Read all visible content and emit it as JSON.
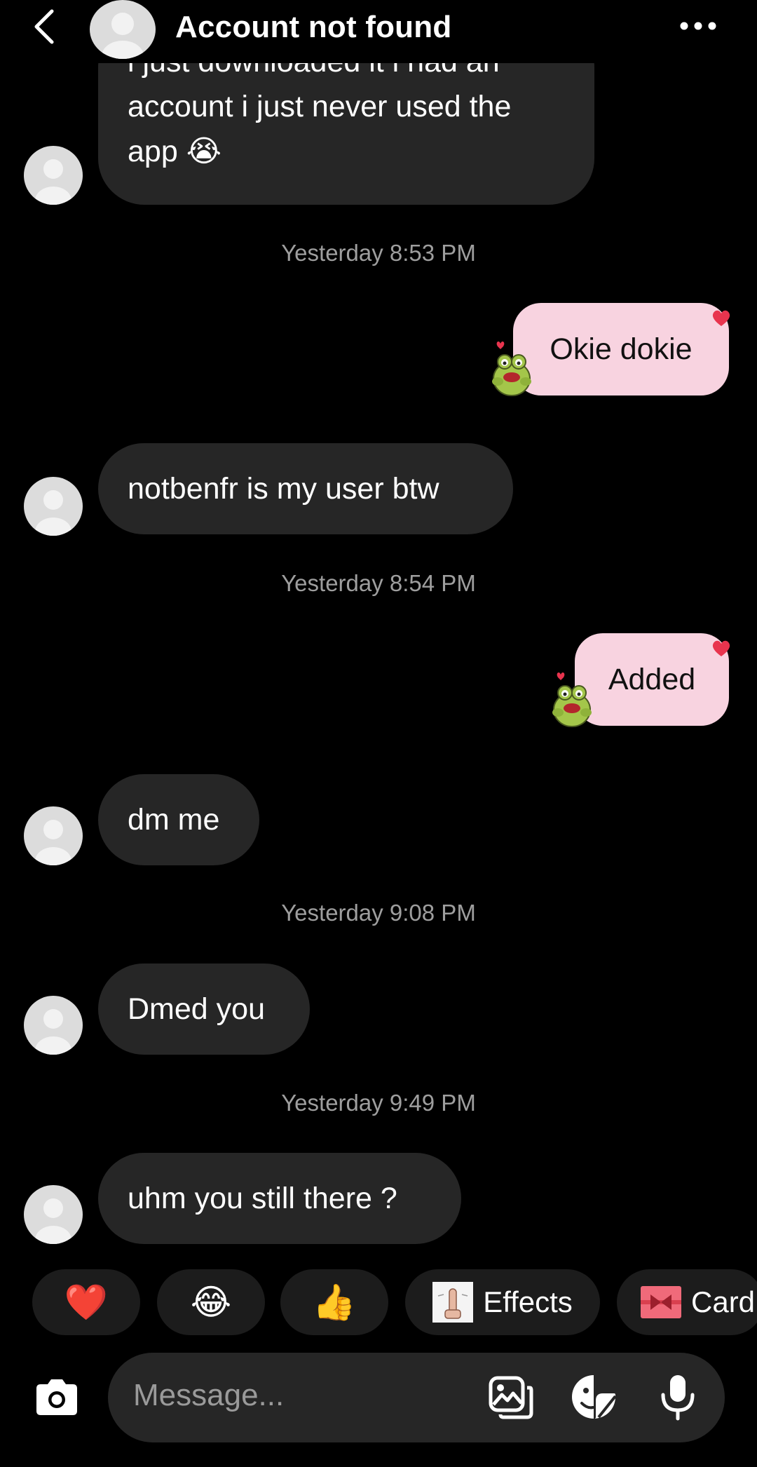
{
  "header": {
    "title": "Account not found"
  },
  "messages": {
    "first_line_partial": "i just downloaded it i had an",
    "first_line2": "account i just never used the",
    "first_line3": "app",
    "first_emoji": "😭",
    "ts1": "Yesterday 8:53 PM",
    "out1": "Okie dokie",
    "in2": "notbenfr is my user btw",
    "ts2": "Yesterday 8:54 PM",
    "out2": "Added",
    "in3": "dm me",
    "ts3": "Yesterday 9:08 PM",
    "in4": "Dmed you",
    "ts4": "Yesterday 9:49 PM",
    "in5": "uhm you still there ?"
  },
  "quick_reactions": {
    "heart": "❤️",
    "laugh": "😂",
    "thumbs": "👍",
    "effects_label": "Effects",
    "card_label": "Card"
  },
  "composer": {
    "placeholder": "Message..."
  },
  "colors": {
    "background": "#000000",
    "incoming_bubble": "#262626",
    "outgoing_bubble": "#f8d3e0",
    "timestamp": "#9e9e9e",
    "heart_accent": "#e8344e"
  },
  "icons": [
    "back-arrow-icon",
    "more-options-icon",
    "camera-icon",
    "gallery-icon",
    "sticker-icon",
    "microphone-icon"
  ]
}
